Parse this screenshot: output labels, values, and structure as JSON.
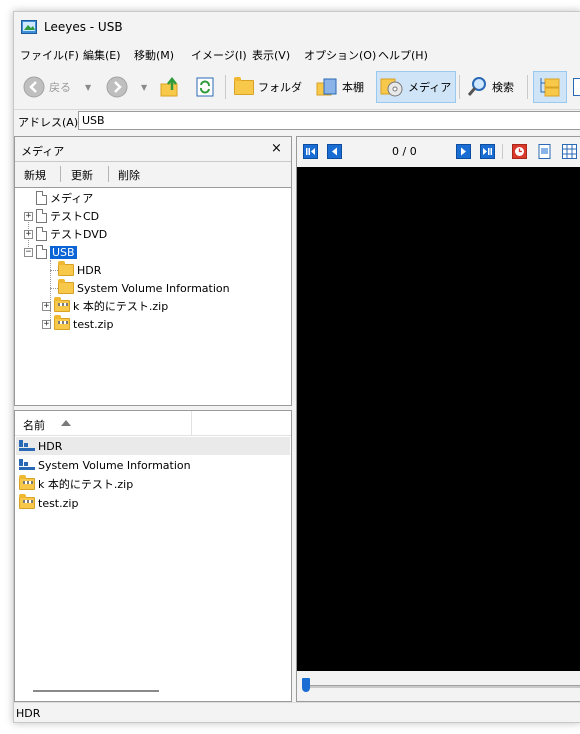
{
  "window": {
    "title": "Leeyes - USB"
  },
  "menu": [
    "ファイル(F)",
    "編集(E)",
    "移動(M)",
    "イメージ(I)",
    "表示(V)",
    "オプション(O)",
    "ヘルプ(H)"
  ],
  "toolbar": {
    "back": "戻る",
    "folder": "フォルダ",
    "bookshelf": "本棚",
    "media": "メディア",
    "search": "検索"
  },
  "address": {
    "label": "アドレス(A)",
    "value": "USB"
  },
  "media_panel": {
    "title": "メディア",
    "close": "×",
    "actions": {
      "new": "新規",
      "refresh": "更新",
      "delete": "削除"
    },
    "tree": {
      "root": "メディア",
      "items": [
        "テストCD",
        "テストDVD",
        "USB"
      ],
      "usb_children": [
        "HDR",
        "System Volume Information",
        "k 本的にテスト.zip",
        "test.zip"
      ]
    }
  },
  "file_list": {
    "column_name": "名前",
    "rows": [
      "HDR",
      "System Volume Information",
      "k 本的にテスト.zip",
      "test.zip"
    ]
  },
  "viewer": {
    "page_counter": "0 / 0"
  },
  "status": {
    "text": "HDR"
  },
  "colors": {
    "accent": "#0a64d6",
    "canvas": "#000000",
    "selection": "#cfe4f7"
  }
}
